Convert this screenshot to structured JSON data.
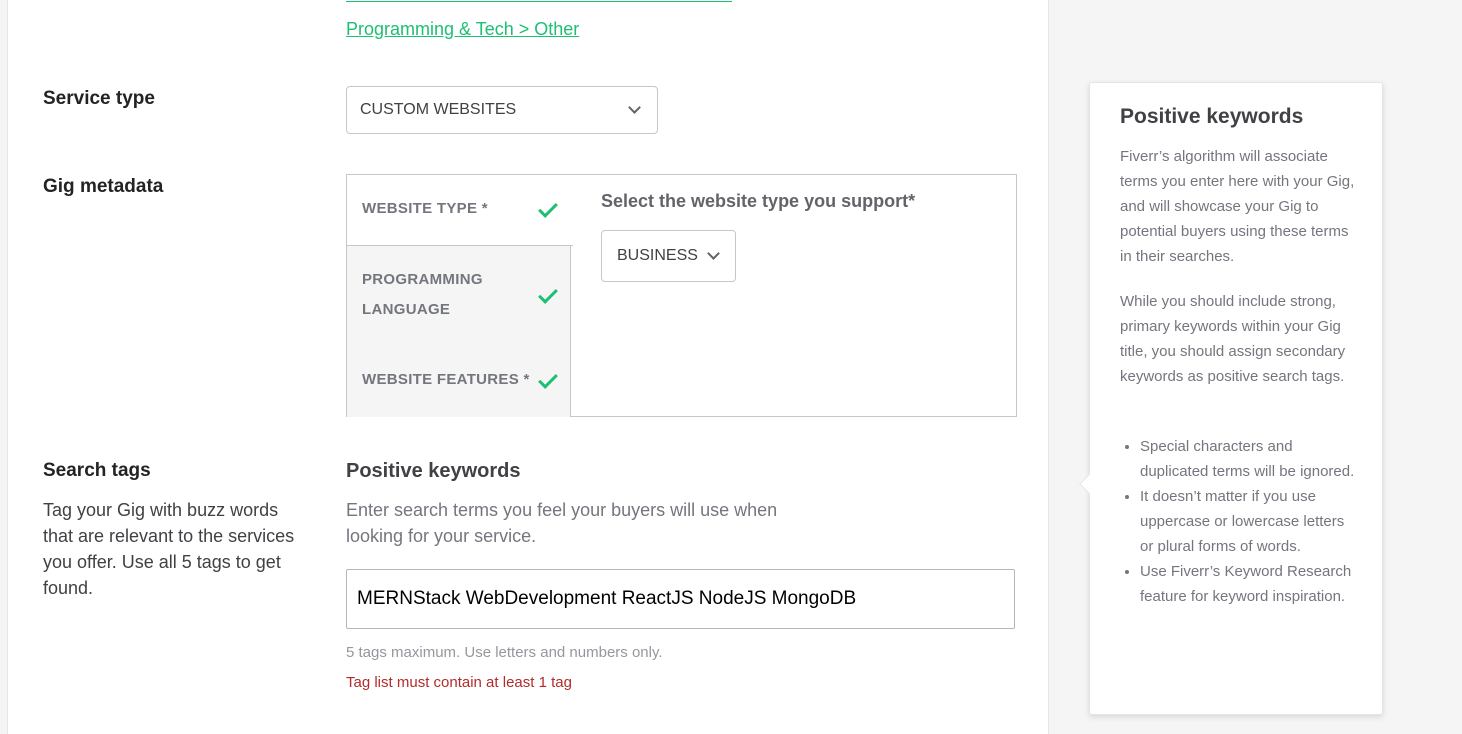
{
  "category": {
    "link_text": "Programming & Tech > Other"
  },
  "service_type": {
    "label": "Service type",
    "selected": "CUSTOM WEBSITES"
  },
  "gig_metadata": {
    "label": "Gig metadata",
    "tabs": [
      {
        "label": "WEBSITE TYPE *",
        "status": "complete"
      },
      {
        "label_line1": "PROGRAMMING",
        "label_line2": "LANGUAGE",
        "status": "complete"
      },
      {
        "label": "WEBSITE FEATURES *",
        "status": "complete"
      }
    ],
    "question": "Select the website type you support*",
    "selected": "BUSINESS"
  },
  "search_tags": {
    "label": "Search tags",
    "description": "Tag your Gig with buzz words that are relevant to the services you offer. Use all 5 tags to get found.",
    "positive_title": "Positive keywords",
    "positive_desc": "Enter search terms you feel your buyers will use when looking for your service.",
    "input_value": "MERNStack WebDevelopment ReactJS NodeJS MongoDB",
    "hint": "5 tags maximum. Use letters and numbers only.",
    "error": "Tag list must contain at least 1 tag"
  },
  "help": {
    "title": "Positive keywords",
    "p1": "Fiverr’s algorithm will associate terms you enter here with your Gig, and will showcase your Gig to potential buyers using these terms in their searches.",
    "p2": "While you should include strong, primary keywords within your Gig title, you should assign secondary keywords as positive search tags.",
    "bullets": [
      "Special characters and duplicated terms will be ignored.",
      "It doesn’t matter if you use uppercase or lowercase letters or plural forms of words.",
      "Use Fiverr’s Keyword Research feature for keyword inspiration."
    ]
  },
  "colors": {
    "accent_green": "#1dbf73",
    "error_red": "#b22c2c"
  }
}
